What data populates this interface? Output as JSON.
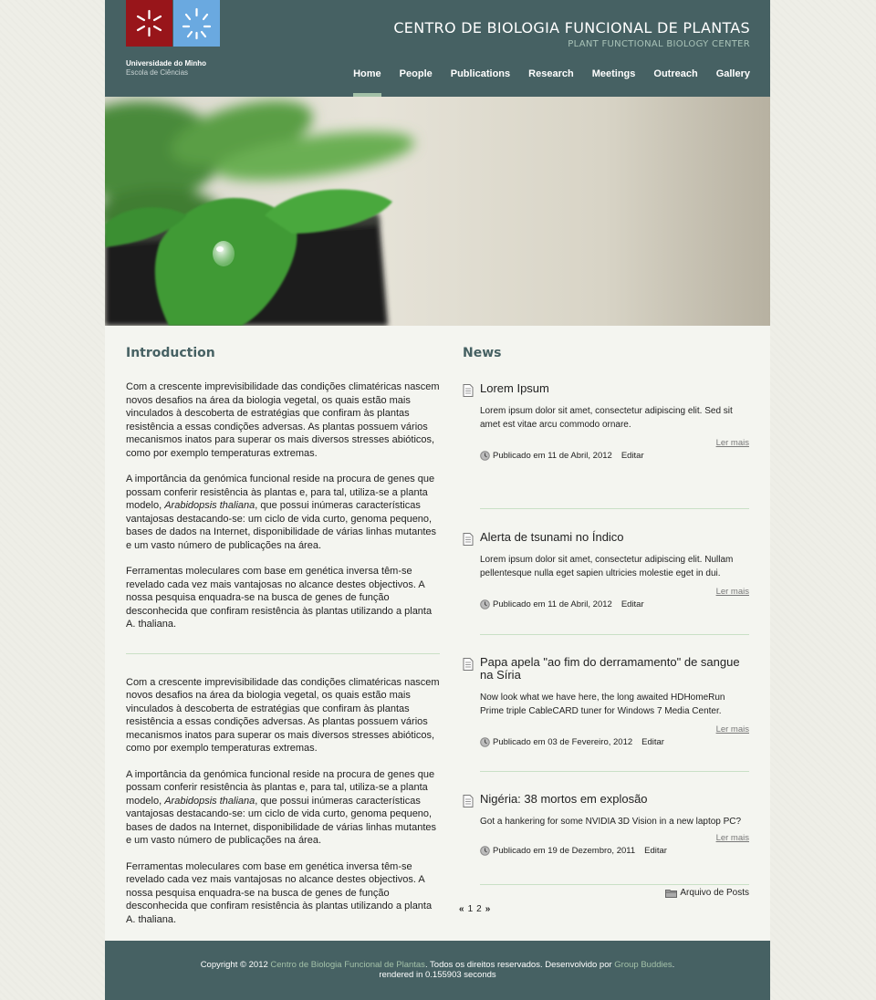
{
  "header": {
    "university_name": "Universidade do Minho",
    "school_name": "Escola de Ciências",
    "site_title": "CENTRO DE BIOLOGIA FUNCIONAL DE PLANTAS",
    "site_subtitle": "PLANT FUNCTIONAL BIOLOGY CENTER",
    "nav": [
      {
        "label": "Home",
        "active": true
      },
      {
        "label": "People"
      },
      {
        "label": "Publications"
      },
      {
        "label": "Research"
      },
      {
        "label": "Meetings"
      },
      {
        "label": "Outreach"
      },
      {
        "label": "Gallery"
      }
    ]
  },
  "intro": {
    "title": "Introduction",
    "blocks": [
      {
        "p1": "Com a crescente imprevisibilidade das condições climatéricas nascem novos desafios na área da biologia vegetal, os quais estão mais vinculados à descoberta de estratégias que confiram às plantas resistência a essas condições adversas. As plantas possuem vários mecanismos inatos para superar os mais diversos stresses abióticos, como por exemplo temperaturas extremas.",
        "p2_before": "A importância da genómica funcional reside na procura de genes que possam conferir resistência às plantas e, para tal, utiliza-se a planta modelo, ",
        "p2_italic": "Arabidopsis thaliana",
        "p2_after": ", que possui inúmeras características vantajosas destacando-se: um ciclo de vida curto, genoma pequeno, bases de dados na Internet, disponibilidade de várias linhas mutantes e um vasto número de publicações na área.",
        "p3": "Ferramentas moleculares com base em genética inversa têm-se revelado cada vez mais vantajosas no alcance destes objectivos. A nossa pesquisa enquadra-se na busca de genes de função desconhecida que confiram resistência às plantas utilizando a planta A. thaliana."
      },
      {
        "p1": "Com a crescente imprevisibilidade das condições climatéricas nascem novos desafios na área da biologia vegetal, os quais estão mais vinculados à descoberta de estratégias que confiram às plantas resistência a essas condições adversas. As plantas possuem vários mecanismos inatos para superar os mais diversos stresses abióticos, como por exemplo temperaturas extremas.",
        "p2_before": "A importância da genómica funcional reside na procura de genes que possam conferir resistência às plantas e, para tal, utiliza-se a planta modelo, ",
        "p2_italic": "Arabidopsis thaliana",
        "p2_after": ", que possui inúmeras características vantajosas destacando-se: um ciclo de vida curto, genoma pequeno, bases de dados na Internet, disponibilidade de várias linhas mutantes e um vasto número de publicações na área.",
        "p3": "Ferramentas moleculares com base em genética inversa têm-se revelado cada vez mais vantajosas no alcance destes objectivos. A nossa pesquisa enquadra-se na busca de genes de função desconhecida que confiram resistência às plantas utilizando a planta A. thaliana."
      }
    ]
  },
  "news": {
    "title": "News",
    "items": [
      {
        "title": "Lorem Ipsum",
        "text": "Lorem ipsum dolor sit amet, consectetur adipiscing elit. Sed sit amet est vitae arcu commodo ornare.",
        "read_more": "Ler mais",
        "published": "Publicado em 11 de Abril, 2012",
        "edit": "Editar"
      },
      {
        "title": "Alerta de tsunami no Índico",
        "text": "Lorem ipsum dolor sit amet, consectetur adipiscing elit. Nullam pellentesque nulla eget sapien ultricies molestie eget in dui.",
        "read_more": "Ler mais",
        "published": "Publicado em 11 de Abril, 2012",
        "edit": "Editar"
      },
      {
        "title": "Papa apela \"ao fim do derramamento\" de sangue na Síria",
        "text": "Now look what we have here, the long awaited HDHomeRun Prime triple CableCARD tuner for Windows 7 Media Center.",
        "read_more": "Ler mais",
        "published": "Publicado em 03 de Fevereiro, 2012",
        "edit": "Editar"
      },
      {
        "title": "Nigéria: 38 mortos em explosão",
        "text": "Got a hankering for some NVIDIA 3D Vision in a new laptop PC?",
        "read_more": "Ler mais",
        "published": "Publicado em 19 de Dezembro, 2011",
        "edit": "Editar"
      }
    ],
    "pager": {
      "first": "«",
      "pages": [
        "1",
        "2"
      ],
      "next": "»"
    },
    "archive_label": "Arquivo de Posts"
  },
  "footer": {
    "copyright_prefix": "Copyright © 2012 ",
    "centre_link": "Centro de Biologia Funcional de Plantas",
    "rights": ". Todos os direitos reservados. Desenvolvido por ",
    "developer_link": "Group Buddies",
    "end": ".",
    "rendered": "rendered in 0.155903 seconds"
  },
  "colors": {
    "header_bg": "#466163",
    "accent_green": "#a3c1a8",
    "logo_red": "#98151a",
    "logo_blue": "#6aa9e0",
    "divider": "#c9e0c6"
  }
}
